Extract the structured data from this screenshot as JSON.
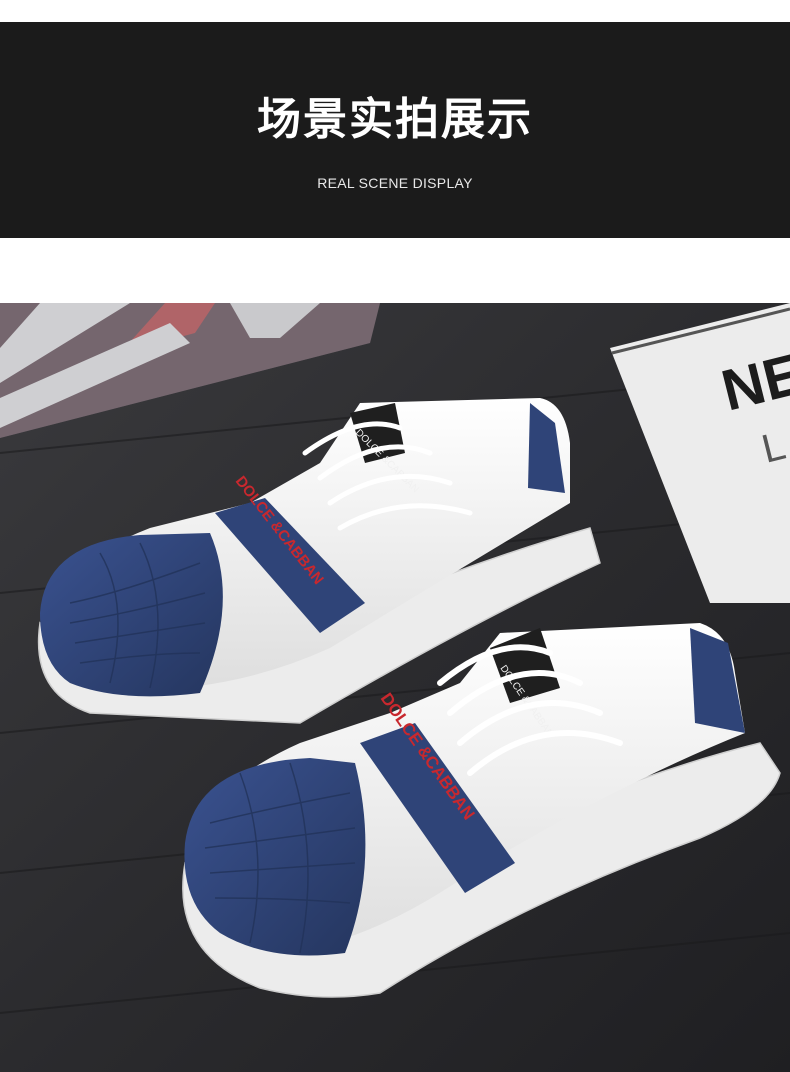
{
  "banner": {
    "title": "场景实拍展示",
    "subtitle": "REAL SCENE DISPLAY"
  },
  "photo": {
    "shoe_strap_text": "DOLCE &CABBAN",
    "tongue_tag_text": "DOLCE &CABBAN",
    "paper_text_large": "NE",
    "paper_text_small": "L",
    "colors": {
      "background": "#2a2a2c",
      "shoe_white": "#f4f4f4",
      "shoe_blue": "#2f4478",
      "strap_text": "#c8282e",
      "banner": "#1b1b1b"
    }
  }
}
